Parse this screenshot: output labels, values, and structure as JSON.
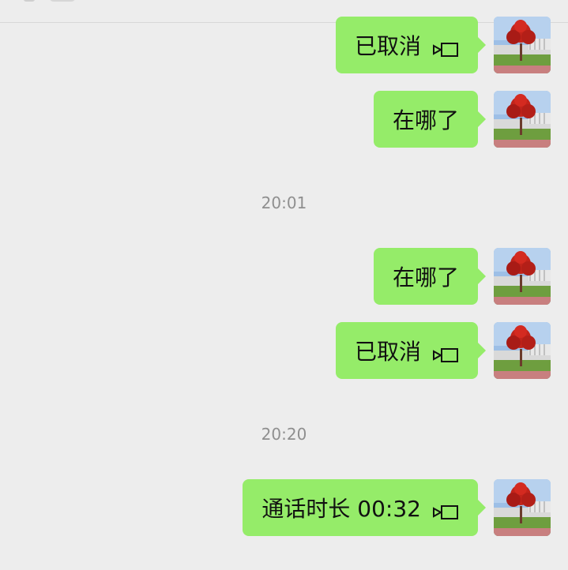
{
  "messages": [
    {
      "text": "已取消",
      "icon": "video-call-icon"
    },
    {
      "text": "在哪了"
    },
    {
      "text": "在哪了"
    },
    {
      "text": "已取消",
      "icon": "video-call-icon"
    },
    {
      "text": "通话时长 00:32",
      "icon": "video-call-icon"
    }
  ],
  "timestamps": [
    "20:01",
    "20:20"
  ],
  "colors": {
    "background": "#ededed",
    "bubble": "#95ec69",
    "text": "#111111",
    "timestamp": "#8f8f8f"
  }
}
